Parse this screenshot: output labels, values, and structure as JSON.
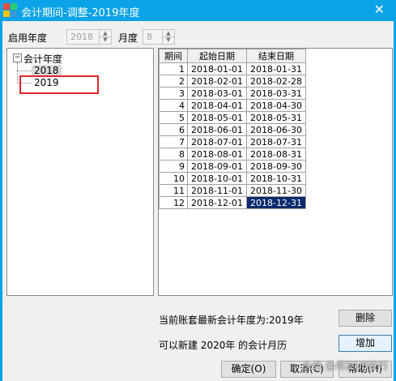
{
  "window": {
    "title": "会计期间-调整-2019年度",
    "close_glyph": "✕"
  },
  "top": {
    "start_year_label": "启用年度",
    "start_year_value": "2018",
    "month_label": "月度",
    "month_value": "8"
  },
  "tree": {
    "toggle": "−",
    "root_label": "会计年度",
    "items": [
      "2018",
      "2019"
    ]
  },
  "table": {
    "headers": [
      "期间",
      "起始日期",
      "结束日期"
    ],
    "rows": [
      [
        "1",
        "2018-01-01",
        "2018-01-31"
      ],
      [
        "2",
        "2018-02-01",
        "2018-02-28"
      ],
      [
        "3",
        "2018-03-01",
        "2018-03-31"
      ],
      [
        "4",
        "2018-04-01",
        "2018-04-30"
      ],
      [
        "5",
        "2018-05-01",
        "2018-05-31"
      ],
      [
        "6",
        "2018-06-01",
        "2018-06-30"
      ],
      [
        "7",
        "2018-07-01",
        "2018-07-31"
      ],
      [
        "8",
        "2018-08-01",
        "2018-08-31"
      ],
      [
        "9",
        "2018-09-01",
        "2018-09-30"
      ],
      [
        "10",
        "2018-10-01",
        "2018-10-31"
      ],
      [
        "11",
        "2018-11-01",
        "2018-11-30"
      ],
      [
        "12",
        "2018-12-01",
        "2018-12-31"
      ]
    ]
  },
  "info": {
    "latest_year_text": "当前账套最新会计年度为:2019年",
    "new_calendar_text": "可以新建 2020年 的会计月历"
  },
  "buttons": {
    "delete": "删除",
    "add": "增加",
    "ok": "确定(O)",
    "cancel": "取消(C)",
    "help": "帮助(H)"
  },
  "watermark": "头条 @用友U8技巧",
  "colors": {
    "titlebar": "#0aa3e8",
    "highlight_box": "#e0262a",
    "selected_cell": "#0a2a6b"
  }
}
